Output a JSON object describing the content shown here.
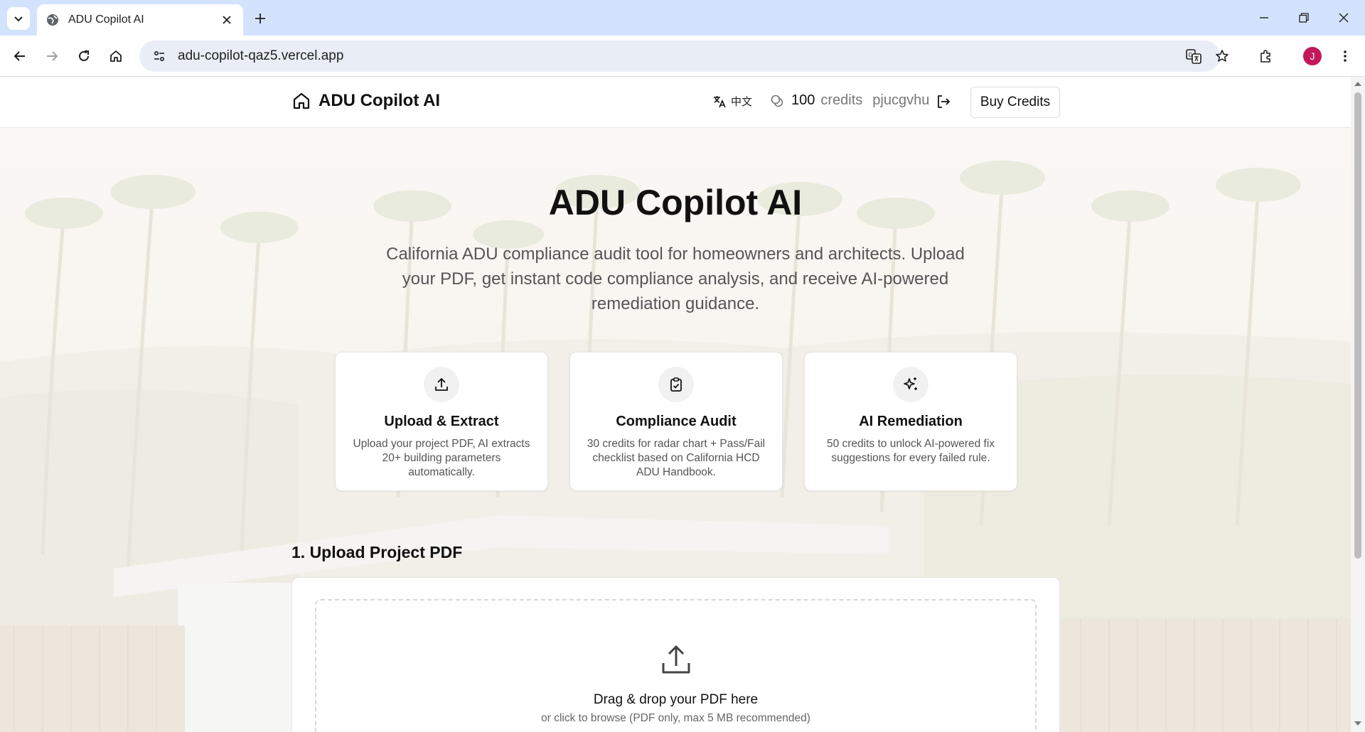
{
  "browser": {
    "tab_title": "ADU Copilot AI",
    "url": "adu-copilot-qaz5.vercel.app",
    "profile_initial": "J",
    "icons": [
      "tab-search-icon",
      "globe-icon",
      "close-icon",
      "plus-icon",
      "minimize-icon",
      "restore-icon",
      "close-window-icon",
      "back-icon",
      "forward-icon",
      "reload-icon",
      "home-icon",
      "site-info-icon",
      "translate-icon",
      "star-icon",
      "extensions-icon",
      "more-icon"
    ]
  },
  "header": {
    "brand": "ADU Copilot AI",
    "language_label": "中文",
    "credits_value": "100",
    "credits_unit": "credits",
    "username": "pjucgvhu",
    "buy_label": "Buy Credits"
  },
  "hero": {
    "title": "ADU Copilot AI",
    "subtitle": "California ADU compliance audit tool for homeowners and architects. Upload your PDF, get instant code compliance analysis, and receive AI-powered remediation guidance."
  },
  "features": [
    {
      "icon": "upload-icon",
      "title": "Upload & Extract",
      "desc": "Upload your project PDF, AI extracts 20+ building parameters automatically."
    },
    {
      "icon": "clipboard-check-icon",
      "title": "Compliance Audit",
      "desc": "30 credits for radar chart + Pass/Fail checklist based on California HCD ADU Handbook."
    },
    {
      "icon": "sparkles-icon",
      "title": "AI Remediation",
      "desc": "50 credits to unlock AI-powered fix suggestions for every failed rule."
    }
  ],
  "upload": {
    "section_title": "1. Upload Project PDF",
    "dropzone_title": "Drag & drop your PDF here",
    "dropzone_hint": "or click to browse (PDF only, max 5 MB recommended)"
  },
  "colors": {
    "tabstrip": "#d3e3fd",
    "omnibox": "#e9eef6",
    "avatar": "#c2185b",
    "text_primary": "#111111",
    "text_muted": "#555555"
  }
}
